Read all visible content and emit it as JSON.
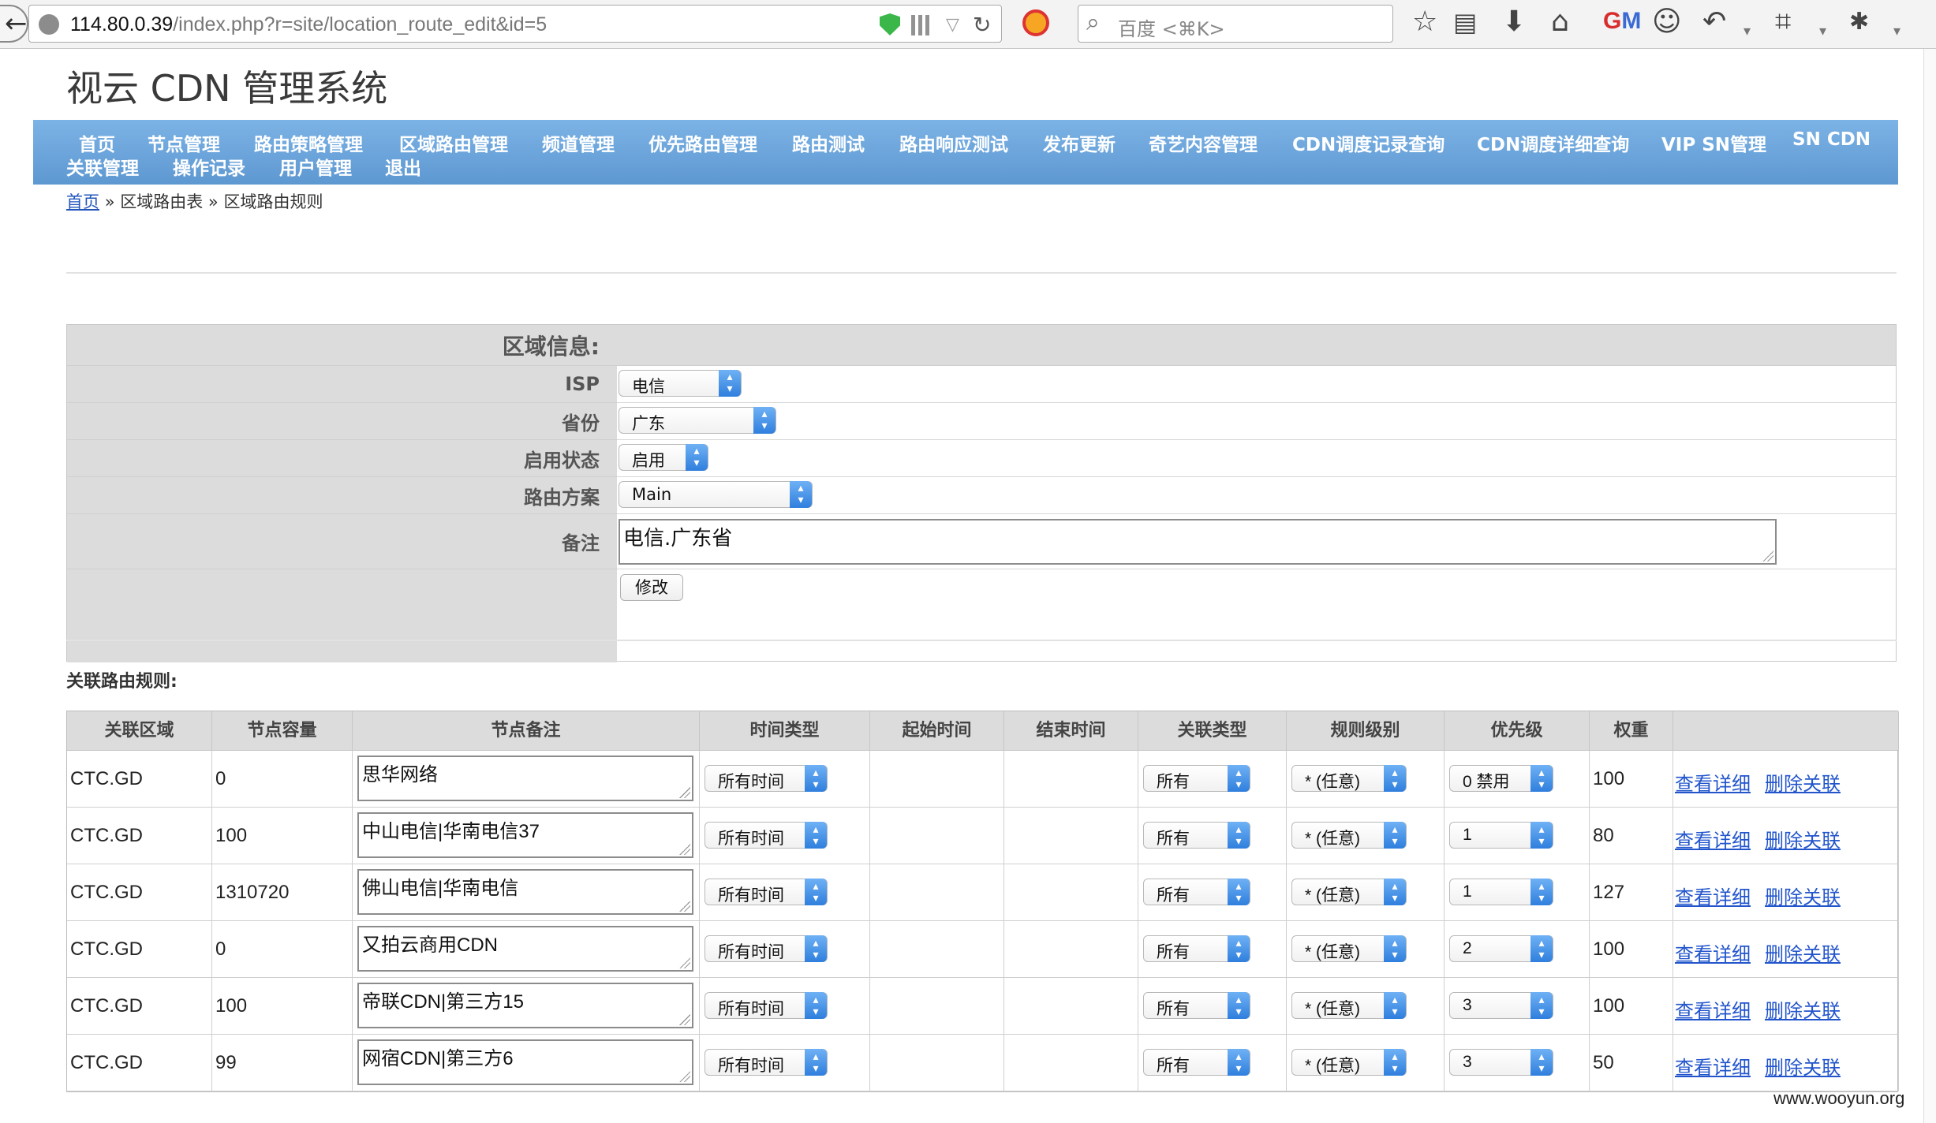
{
  "browser": {
    "url_domain": "114.80.0.39",
    "url_path": "/index.php?r=site/location_route_edit&id=5",
    "search_placeholder": "百度 <⌘K>"
  },
  "site": {
    "title": "视云 CDN 管理系统",
    "nav": [
      "首页",
      "节点管理",
      "路由策略管理",
      "区域路由管理",
      "频道管理",
      "优先路由管理",
      "路由测试",
      "路由响应测试",
      "发布更新",
      "奇艺内容管理",
      "CDN调度记录查询",
      "CDN调度详细查询",
      "VIP SN管理",
      "SN CDN",
      "关联管理",
      "操作记录",
      "用户管理",
      "退出"
    ]
  },
  "breadcrumb": {
    "home": "首页",
    "sep1": "»",
    "level2": "区域路由表",
    "sep2": "»",
    "current": "区域路由规则"
  },
  "region_form": {
    "heading": "区域信息:",
    "isp_label": "ISP",
    "isp_value": "电信",
    "province_label": "省份",
    "province_value": "广东",
    "status_label": "启用状态",
    "status_value": "启用",
    "plan_label": "路由方案",
    "plan_value": "Main",
    "note_label": "备注",
    "note_value": "电信.广东省",
    "submit_label": "修改"
  },
  "rules": {
    "title": "关联路由规则:",
    "columns": [
      "关联区域",
      "节点容量",
      "节点备注",
      "时间类型",
      "起始时间",
      "结束时间",
      "关联类型",
      "规则级别",
      "优先级",
      "权重"
    ],
    "rows": [
      {
        "region": "CTC.GD",
        "capacity": "0",
        "note": "思华网络",
        "time_type": "所有时间",
        "start": "",
        "end": "",
        "link_type": "所有",
        "level": "* (任意)",
        "priority": "0 禁用",
        "weight": "100",
        "detail": "查看详细",
        "delete": "删除关联"
      },
      {
        "region": "CTC.GD",
        "capacity": "100",
        "note": "中山电信|华南电信37",
        "time_type": "所有时间",
        "start": "",
        "end": "",
        "link_type": "所有",
        "level": "* (任意)",
        "priority": "1",
        "weight": "80",
        "detail": "查看详细",
        "delete": "删除关联"
      },
      {
        "region": "CTC.GD",
        "capacity": "1310720",
        "note": "佛山电信|华南电信",
        "time_type": "所有时间",
        "start": "",
        "end": "",
        "link_type": "所有",
        "level": "* (任意)",
        "priority": "1",
        "weight": "127",
        "detail": "查看详细",
        "delete": "删除关联"
      },
      {
        "region": "CTC.GD",
        "capacity": "0",
        "note": "又拍云商用CDN",
        "time_type": "所有时间",
        "start": "",
        "end": "",
        "link_type": "所有",
        "level": "* (任意)",
        "priority": "2",
        "weight": "100",
        "detail": "查看详细",
        "delete": "删除关联"
      },
      {
        "region": "CTC.GD",
        "capacity": "100",
        "note": "帝联CDN|第三方15",
        "time_type": "所有时间",
        "start": "",
        "end": "",
        "link_type": "所有",
        "level": "* (任意)",
        "priority": "3",
        "weight": "100",
        "detail": "查看详细",
        "delete": "删除关联"
      },
      {
        "region": "CTC.GD",
        "capacity": "99",
        "note": "网宿CDN|第三方6",
        "time_type": "所有时间",
        "start": "",
        "end": "",
        "link_type": "所有",
        "level": "* (任意)",
        "priority": "3",
        "weight": "50",
        "detail": "查看详细",
        "delete": "删除关联"
      }
    ]
  },
  "watermark": "www.wooyun.org",
  "icons": {
    "back": "back-arrow-icon",
    "reload": "reload-icon",
    "search": "search-icon",
    "bookmark": "star-icon"
  }
}
